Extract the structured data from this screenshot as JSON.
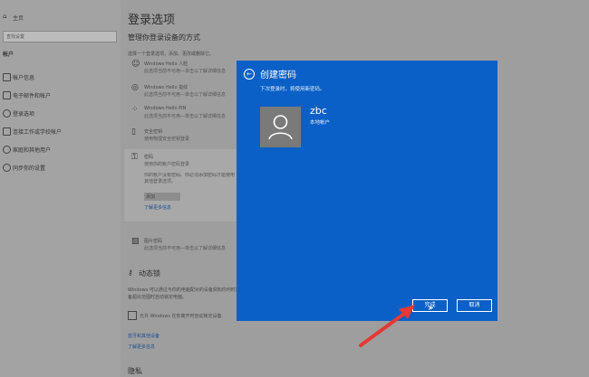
{
  "sidebar": {
    "home": "主页",
    "search_placeholder": "查找设置",
    "section": "帐户",
    "items": [
      {
        "label": "帐户信息",
        "icon": "person-card-icon"
      },
      {
        "label": "电子邮件和帐户",
        "icon": "mail-icon"
      },
      {
        "label": "登录选项",
        "icon": "key-icon"
      },
      {
        "label": "连接工作或学校帐户",
        "icon": "briefcase-icon"
      },
      {
        "label": "家庭和其他用户",
        "icon": "people-icon"
      },
      {
        "label": "同步你的设置",
        "icon": "sync-icon"
      }
    ]
  },
  "main": {
    "title": "登录选项",
    "subtitle": "管理你登录设备的方式",
    "intro": "选择一个登录选项，添加、更改或删除它。",
    "options": [
      {
        "icon": "face-icon",
        "title": "Windows Hello 人脸",
        "desc": "此选项当前不可用—单击以了解详细信息"
      },
      {
        "icon": "fingerprint-icon",
        "title": "Windows Hello 指纹",
        "desc": "此选项当前不可用—单击以了解详细信息"
      },
      {
        "icon": "pin-icon",
        "title": "Windows Hello PIN",
        "desc": "此选项当前不可用—单击以了解详细信息"
      },
      {
        "icon": "usb-key-icon",
        "title": "安全密钥",
        "desc": "使用物理安全密钥登录"
      }
    ],
    "password": {
      "title": "密码",
      "desc": "使用你的帐户密码登录",
      "note": "你的帐户没有密码。你必须添加密码才能使用其他登录选项。",
      "add_label": "添加",
      "learn_more": "了解更多信息"
    },
    "picture_password": {
      "title": "图片密码",
      "desc": "此选项当前不可用—单击以了解详细信息"
    },
    "dynamic_lock": {
      "title": "动态锁",
      "desc1": "Windows 可以通过与你的电脑配对的设备获知你何时离开，并",
      "desc2": "备超出范围时自动锁定电脑。",
      "checkbox_label": "允许 Windows 在你离开时自动锁定设备"
    },
    "links": [
      "蓝牙和其他设备",
      "了解更多信息"
    ],
    "privacy": "隐私"
  },
  "dialog": {
    "title": "创建密码",
    "subtitle": "下次登录时，将使用新密码。",
    "user_name": "zbc",
    "user_type": "本地帐户",
    "finish_label": "完成",
    "cancel_label": "取消"
  },
  "colors": {
    "dialog_bg": "#0a60c6",
    "arrow": "#e53935"
  }
}
